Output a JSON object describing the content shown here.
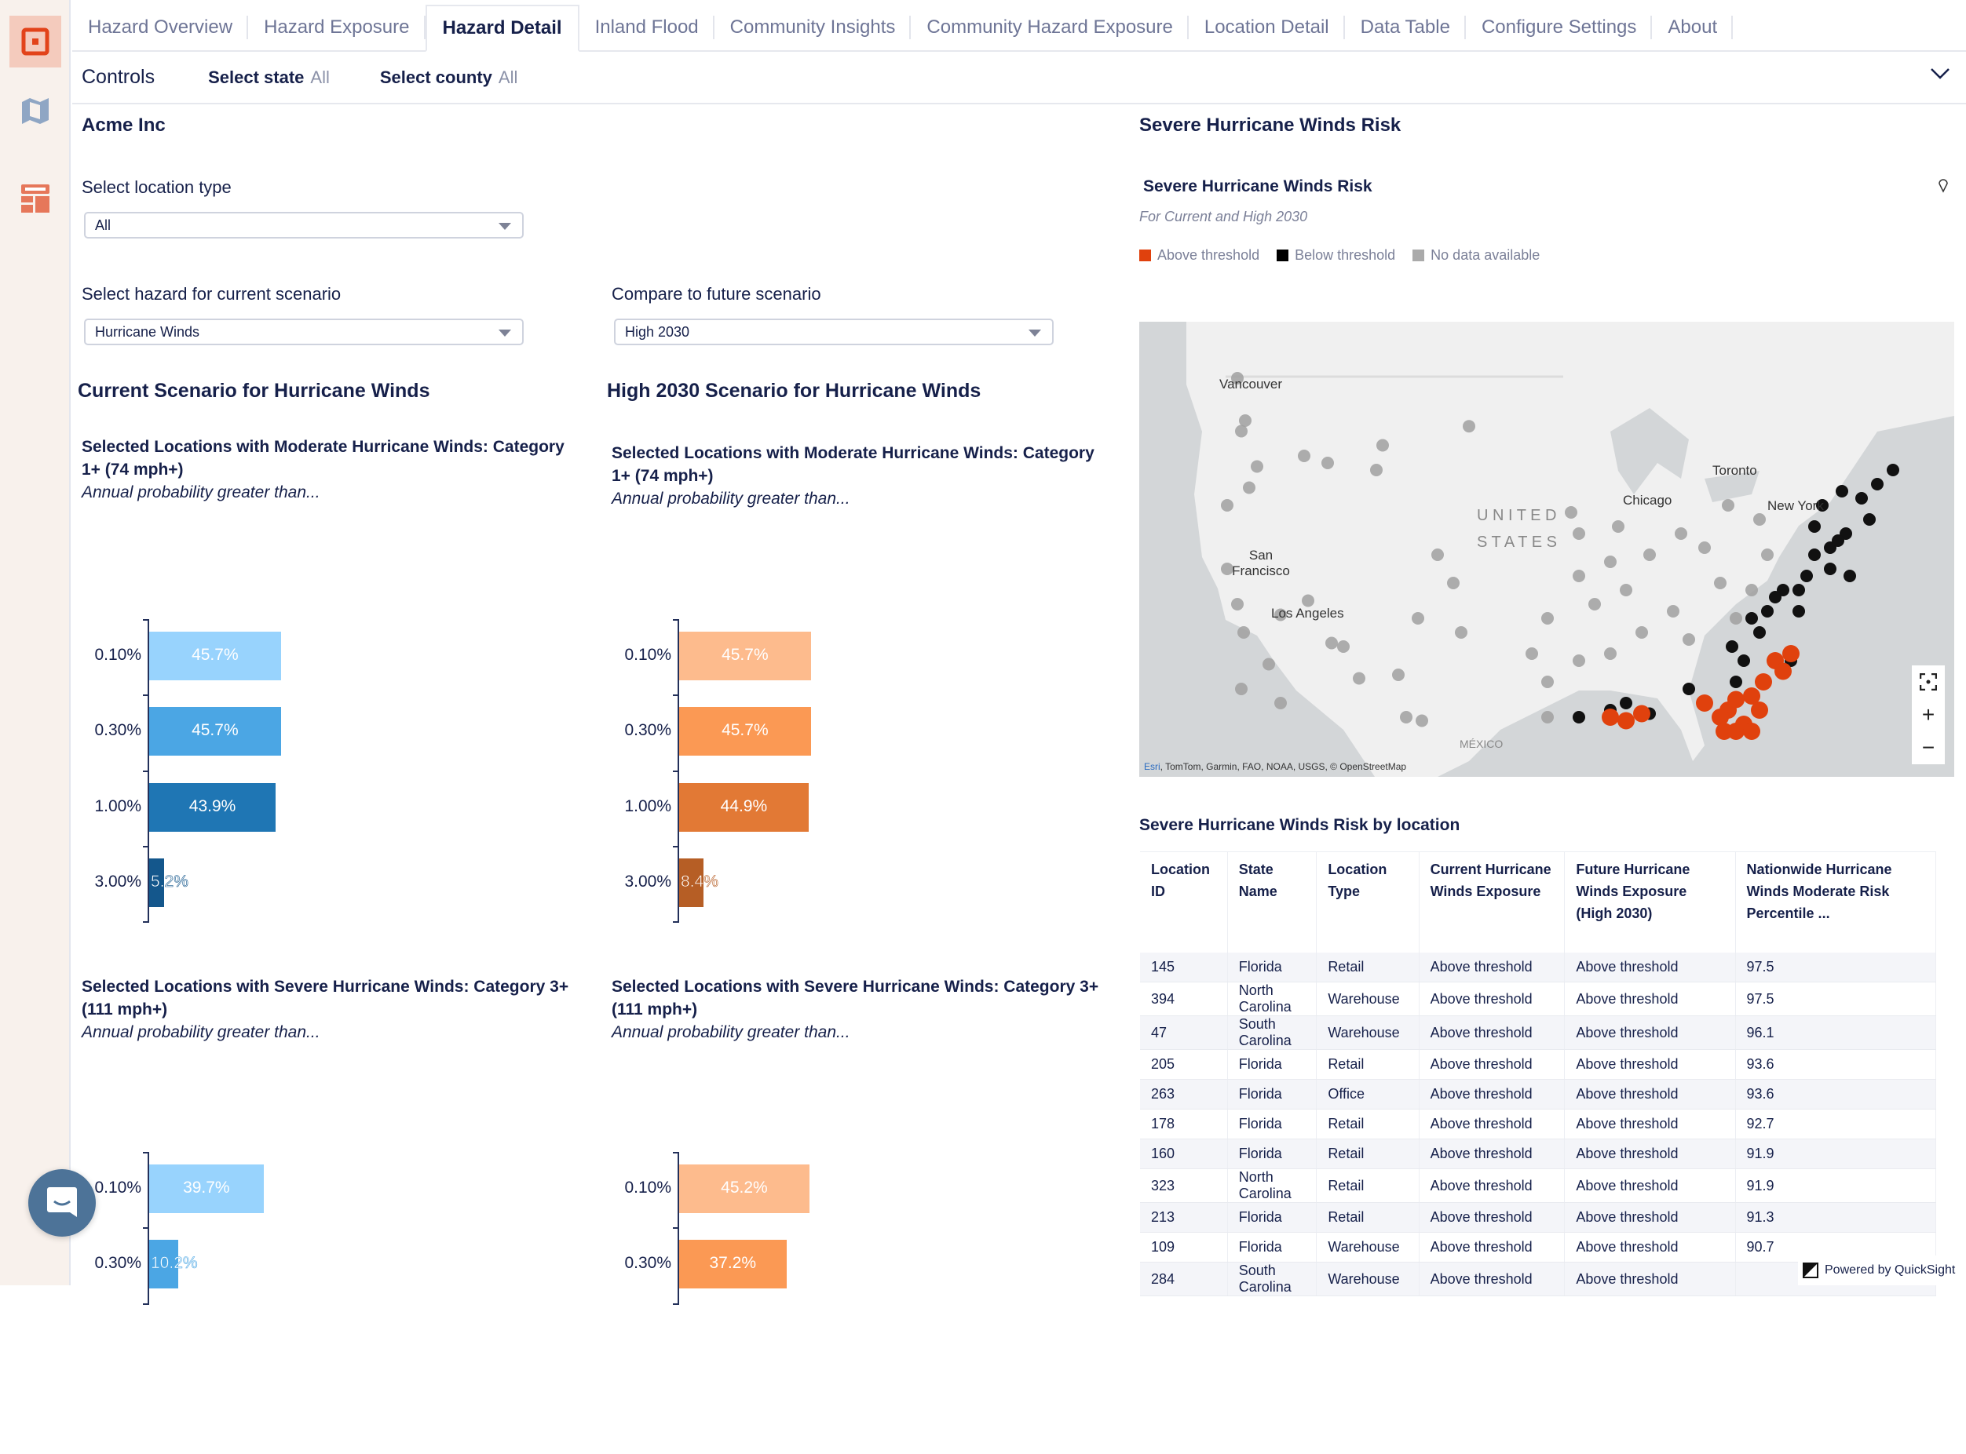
{
  "tabs": [
    {
      "label": "Hazard Overview",
      "active": false
    },
    {
      "label": "Hazard Exposure",
      "active": false
    },
    {
      "label": "Hazard Detail",
      "active": true
    },
    {
      "label": "Inland Flood",
      "active": false
    },
    {
      "label": "Community Insights",
      "active": false
    },
    {
      "label": "Community Hazard Exposure",
      "active": false
    },
    {
      "label": "Location Detail",
      "active": false
    },
    {
      "label": "Data Table",
      "active": false
    },
    {
      "label": "Configure Settings",
      "active": false
    },
    {
      "label": "About",
      "active": false
    }
  ],
  "sidebar": {
    "items": [
      {
        "icon": "dashboard-icon",
        "active": true
      },
      {
        "icon": "map-icon",
        "active": false
      },
      {
        "icon": "layout-icon",
        "active": false
      }
    ]
  },
  "controls": {
    "title": "Controls",
    "state_label": "Select state",
    "state_value": "All",
    "county_label": "Select county",
    "county_value": "All"
  },
  "left": {
    "org": "Acme Inc",
    "location_type_label": "Select location type",
    "location_type_value": "All",
    "hazard_label": "Select hazard for current scenario",
    "hazard_value": "Hurricane Winds",
    "future_label": "Compare to future scenario",
    "future_value": "High 2030",
    "current_title": "Current Scenario for Hurricane Winds",
    "future_title": "High 2030 Scenario for Hurricane Winds"
  },
  "chart_data": [
    {
      "type": "bar",
      "orientation": "horizontal",
      "title": "Selected Locations with Moderate Hurricane Winds: Category 1+ (74 mph+)",
      "subtitle": "Annual probability greater than...",
      "scenario": "Current",
      "categories": [
        "0.10%",
        "0.30%",
        "1.00%",
        "3.00%"
      ],
      "values": [
        45.7,
        45.7,
        43.9,
        5.2
      ],
      "labels": [
        "45.7%",
        "45.7%",
        "43.9%",
        "5.2%"
      ],
      "colors": [
        "#98d3fd",
        "#4ba6e4",
        "#1f76b4",
        "#14578c"
      ]
    },
    {
      "type": "bar",
      "orientation": "horizontal",
      "title": "Selected Locations with Moderate Hurricane Winds: Category 1+ (74 mph+)",
      "subtitle": "Annual probability greater than...",
      "scenario": "High 2030",
      "categories": [
        "0.10%",
        "0.30%",
        "1.00%",
        "3.00%"
      ],
      "values": [
        45.7,
        45.7,
        44.9,
        8.4
      ],
      "labels": [
        "45.7%",
        "45.7%",
        "44.9%",
        "8.4%"
      ],
      "colors": [
        "#fdbb8d",
        "#fb9954",
        "#e27935",
        "#b65e25"
      ]
    },
    {
      "type": "bar",
      "orientation": "horizontal",
      "title": "Selected Locations with Severe Hurricane Winds: Category 3+ (111 mph+)",
      "subtitle": "Annual probability greater than...",
      "scenario": "Current",
      "categories": [
        "0.10%",
        "0.30%"
      ],
      "values": [
        39.7,
        10.2
      ],
      "labels": [
        "39.7%",
        "10.2%"
      ],
      "colors": [
        "#98d3fd",
        "#4ba6e4"
      ]
    },
    {
      "type": "bar",
      "orientation": "horizontal",
      "title": "Selected Locations with Severe Hurricane Winds: Category 3+ (111 mph+)",
      "subtitle": "Annual probability greater than...",
      "scenario": "High 2030",
      "categories": [
        "0.10%",
        "0.30%"
      ],
      "values": [
        45.2,
        37.2
      ],
      "labels": [
        "45.2%",
        "37.2%"
      ],
      "colors": [
        "#fdbb8d",
        "#fb9954"
      ]
    }
  ],
  "right": {
    "title": "Severe Hurricane Winds Risk",
    "map_title": "Severe Hurricane Winds Risk",
    "map_subtitle": "For Current and High 2030",
    "legend": [
      {
        "label": "Above threshold",
        "color": "#e0410d"
      },
      {
        "label": "Below threshold",
        "color": "#000000"
      },
      {
        "label": "No data available",
        "color": "#aaaaaa"
      }
    ],
    "map_labels": {
      "vancouver": "Vancouver",
      "sf": "San Francisco",
      "la": "Los Angeles",
      "us1": "U N I T E D",
      "us2": "S T A T E S",
      "chicago": "Chicago",
      "toronto": "Toronto",
      "ny": "New York",
      "mexico": "MÉXICO"
    },
    "attribution_link": "Esri",
    "attribution": ", TomTom, Garmin, FAO, NOAA, USGS, © OpenStreetMap",
    "zoom_in": "+",
    "zoom_out": "−",
    "table_title": "Severe Hurricane Winds Risk by location",
    "table_headers": [
      "Location ID",
      "State Name",
      "Location Type",
      "Current Hurricane Winds Exposure",
      "Future Hurricane Winds Exposure (High 2030)",
      "Nationwide Hurricane Winds Moderate Risk Percentile ..."
    ],
    "table_rows": [
      [
        "145",
        "Florida",
        "Retail",
        "Above threshold",
        "Above threshold",
        "97.5"
      ],
      [
        "394",
        "North Carolina",
        "Warehouse",
        "Above threshold",
        "Above threshold",
        "97.5"
      ],
      [
        "47",
        "South Carolina",
        "Warehouse",
        "Above threshold",
        "Above threshold",
        "96.1"
      ],
      [
        "205",
        "Florida",
        "Retail",
        "Above threshold",
        "Above threshold",
        "93.6"
      ],
      [
        "263",
        "Florida",
        "Office",
        "Above threshold",
        "Above threshold",
        "93.6"
      ],
      [
        "178",
        "Florida",
        "Retail",
        "Above threshold",
        "Above threshold",
        "92.7"
      ],
      [
        "160",
        "Florida",
        "Retail",
        "Above threshold",
        "Above threshold",
        "91.9"
      ],
      [
        "323",
        "North Carolina",
        "Retail",
        "Above threshold",
        "Above threshold",
        "91.9"
      ],
      [
        "213",
        "Florida",
        "Retail",
        "Above threshold",
        "Above threshold",
        "91.3"
      ],
      [
        "109",
        "Florida",
        "Warehouse",
        "Above threshold",
        "Above threshold",
        "90.7"
      ],
      [
        "284",
        "South Carolina",
        "Warehouse",
        "Above threshold",
        "Above threshold",
        ""
      ]
    ]
  },
  "footer": {
    "powered": "Powered by QuickSight"
  }
}
